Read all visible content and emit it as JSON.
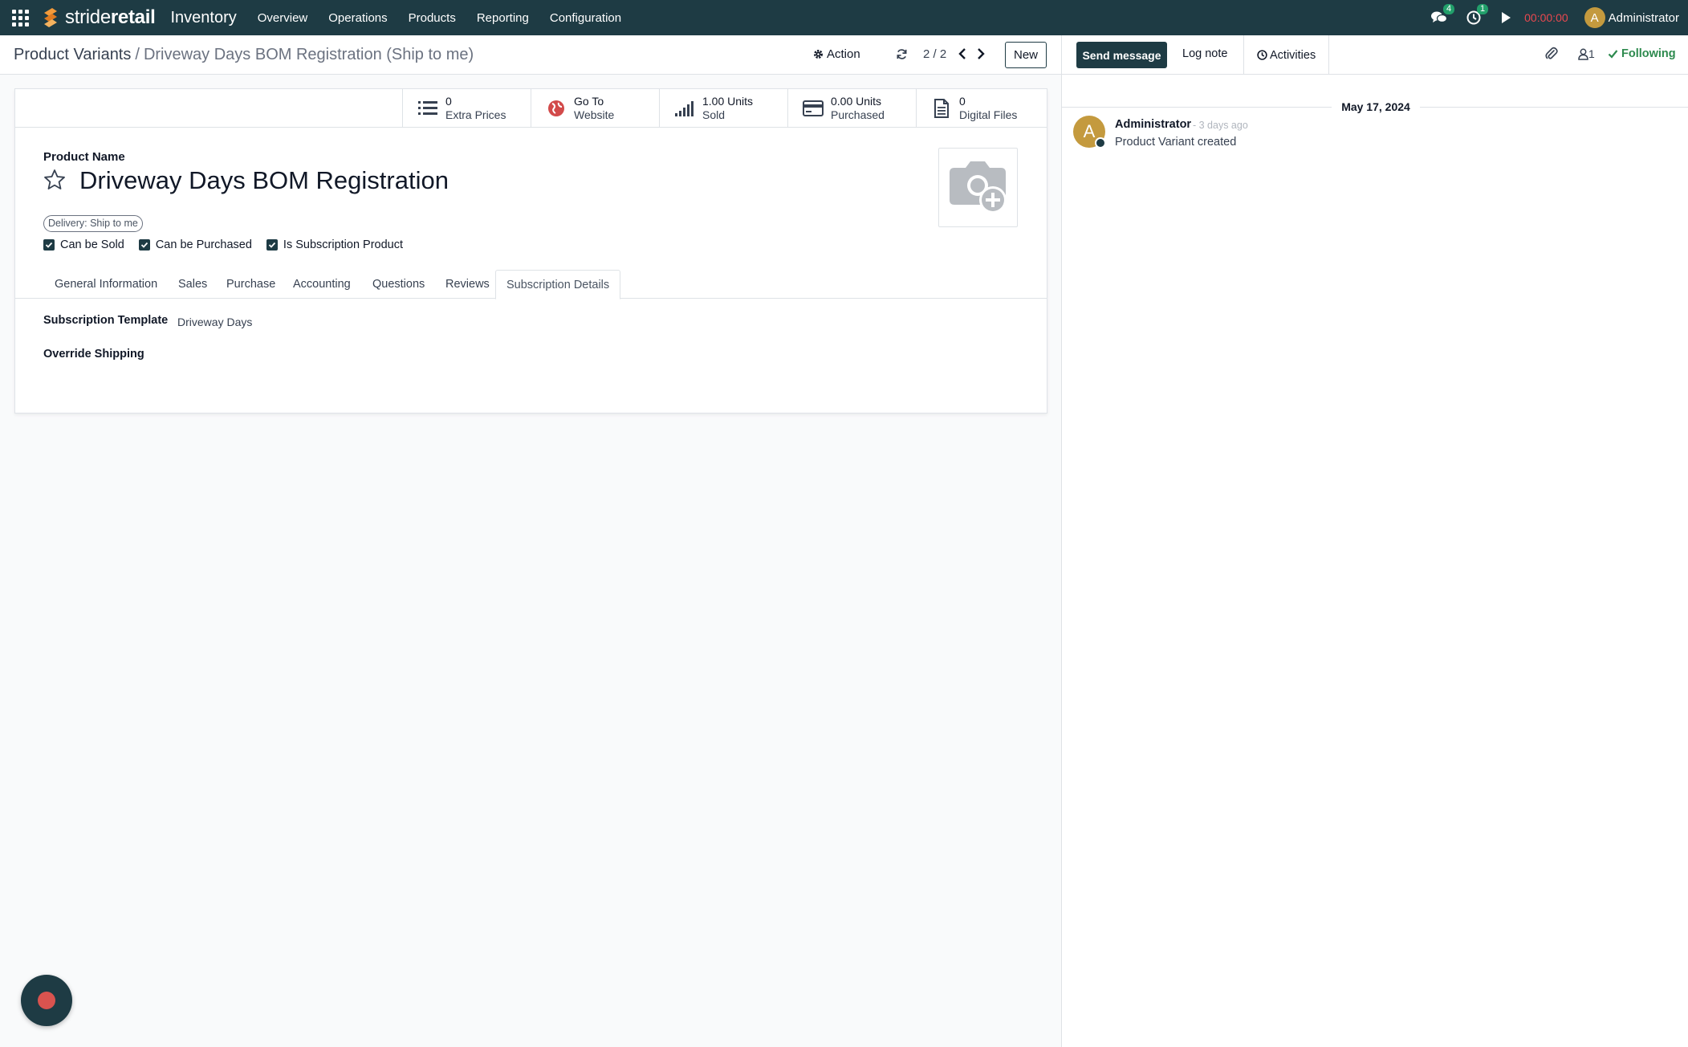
{
  "navbar": {
    "brand_first": "stride",
    "brand_second": "retail",
    "app_name": "Inventory",
    "menu": [
      "Overview",
      "Operations",
      "Products",
      "Reporting",
      "Configuration"
    ],
    "messages_count": "4",
    "activities_count": "1",
    "timer": "00:00:00",
    "user_initial": "A",
    "user_name": "Administrator"
  },
  "control": {
    "breadcrumb_parent": "Product Variants",
    "breadcrumb_separator": "/",
    "breadcrumb_current": "Driveway Days BOM Registration (Ship to me)",
    "action_label": "Action",
    "pager": "2 / 2",
    "new_label": "New"
  },
  "smart_buttons": [
    {
      "value": "0",
      "label": "Extra Prices",
      "icon": "list-icon"
    },
    {
      "value": "Go To",
      "label": "Website",
      "icon": "globe-icon"
    },
    {
      "value": "1.00 Units",
      "label": "Sold",
      "icon": "signal-icon"
    },
    {
      "value": "0.00 Units",
      "label": "Purchased",
      "icon": "credit-card-icon"
    },
    {
      "value": "0",
      "label": "Digital Files",
      "icon": "file-icon"
    }
  ],
  "form": {
    "product_name_label": "Product Name",
    "product_name": "Driveway Days BOM Registration",
    "tag": "Delivery: Ship to me",
    "checkboxes": [
      {
        "label": "Can be Sold",
        "checked": true
      },
      {
        "label": "Can be Purchased",
        "checked": true
      },
      {
        "label": "Is Subscription Product",
        "checked": true
      }
    ],
    "tabs": [
      "General Information",
      "Sales",
      "Purchase",
      "Accounting",
      "Questions",
      "Reviews",
      "Subscription Details"
    ],
    "active_tab": "Subscription Details",
    "subscription_template_label": "Subscription Template",
    "subscription_template_value": "Driveway Days",
    "override_shipping_label": "Override Shipping"
  },
  "chatter": {
    "send_message": "Send message",
    "log_note": "Log note",
    "activities": "Activities",
    "followers_count": "1",
    "following": "Following",
    "date": "May 17, 2024",
    "message": {
      "author_initial": "A",
      "author": "Administrator",
      "time": "- 3 days ago",
      "body": "Product Variant created"
    }
  },
  "colors": {
    "primary": "#1e3b44",
    "badge_green": "#22a06b",
    "timer_red": "#e8484f",
    "avatar_gold": "#c49a3e",
    "following_green": "#2d8a4e"
  }
}
